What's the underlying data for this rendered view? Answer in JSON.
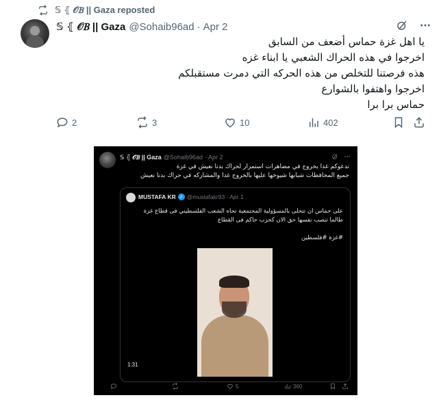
{
  "repost": {
    "label": "𝕊 ⦃ 𝒪𝐵 || Gaza reposted"
  },
  "post": {
    "author_name": "𝕊 ⦃ 𝒪𝐵 || Gaza",
    "handle": "@Sohaib96ad",
    "dot": "·",
    "date": "Apr 2",
    "lines": [
      "يا اهل غزة حماس أضعف من السابق",
      "اخرجوا في هذه الحراك الشعبي يا ابناء غزه",
      "هذه فرصتنا للتخلص من هذه الحركه التي دمرت مستقبلكم",
      "اخرجوا واهتفوا بالشوارع",
      "حماس برا برا"
    ],
    "replies": "2",
    "reposts": "3",
    "likes": "10",
    "views": "402"
  },
  "screenshot": {
    "author_name": "𝕊 ⦃ 𝒪𝐵 || Gaza",
    "handle": "@Sohaib96ad",
    "date": "· Apr 2",
    "lines": [
      "تدعوكم غدا بخروج في مضاهرات استمرار لحراك بدنا نعيش في غزة",
      "جميع المحافظات شبابها شيوخها عليها بالخروج غدا والمشاركه في حراك بدنا نعيش"
    ],
    "quote": {
      "author_name": "MUSTAFA KR",
      "verified": "✓",
      "handle": "@mustafakr93 · Apr 1",
      "lines": [
        "على حماس ان تتحلى بالمسؤولية المجتمعية تجاه الشعب الفلسطيني فى قطاع غزة",
        "طالما تنصب نفسها حق الان كحزب حاكم فى القطاع"
      ],
      "hashtags": "#غزة #فلسطين",
      "duration": "1:31"
    },
    "likes": "5",
    "views": "360"
  }
}
